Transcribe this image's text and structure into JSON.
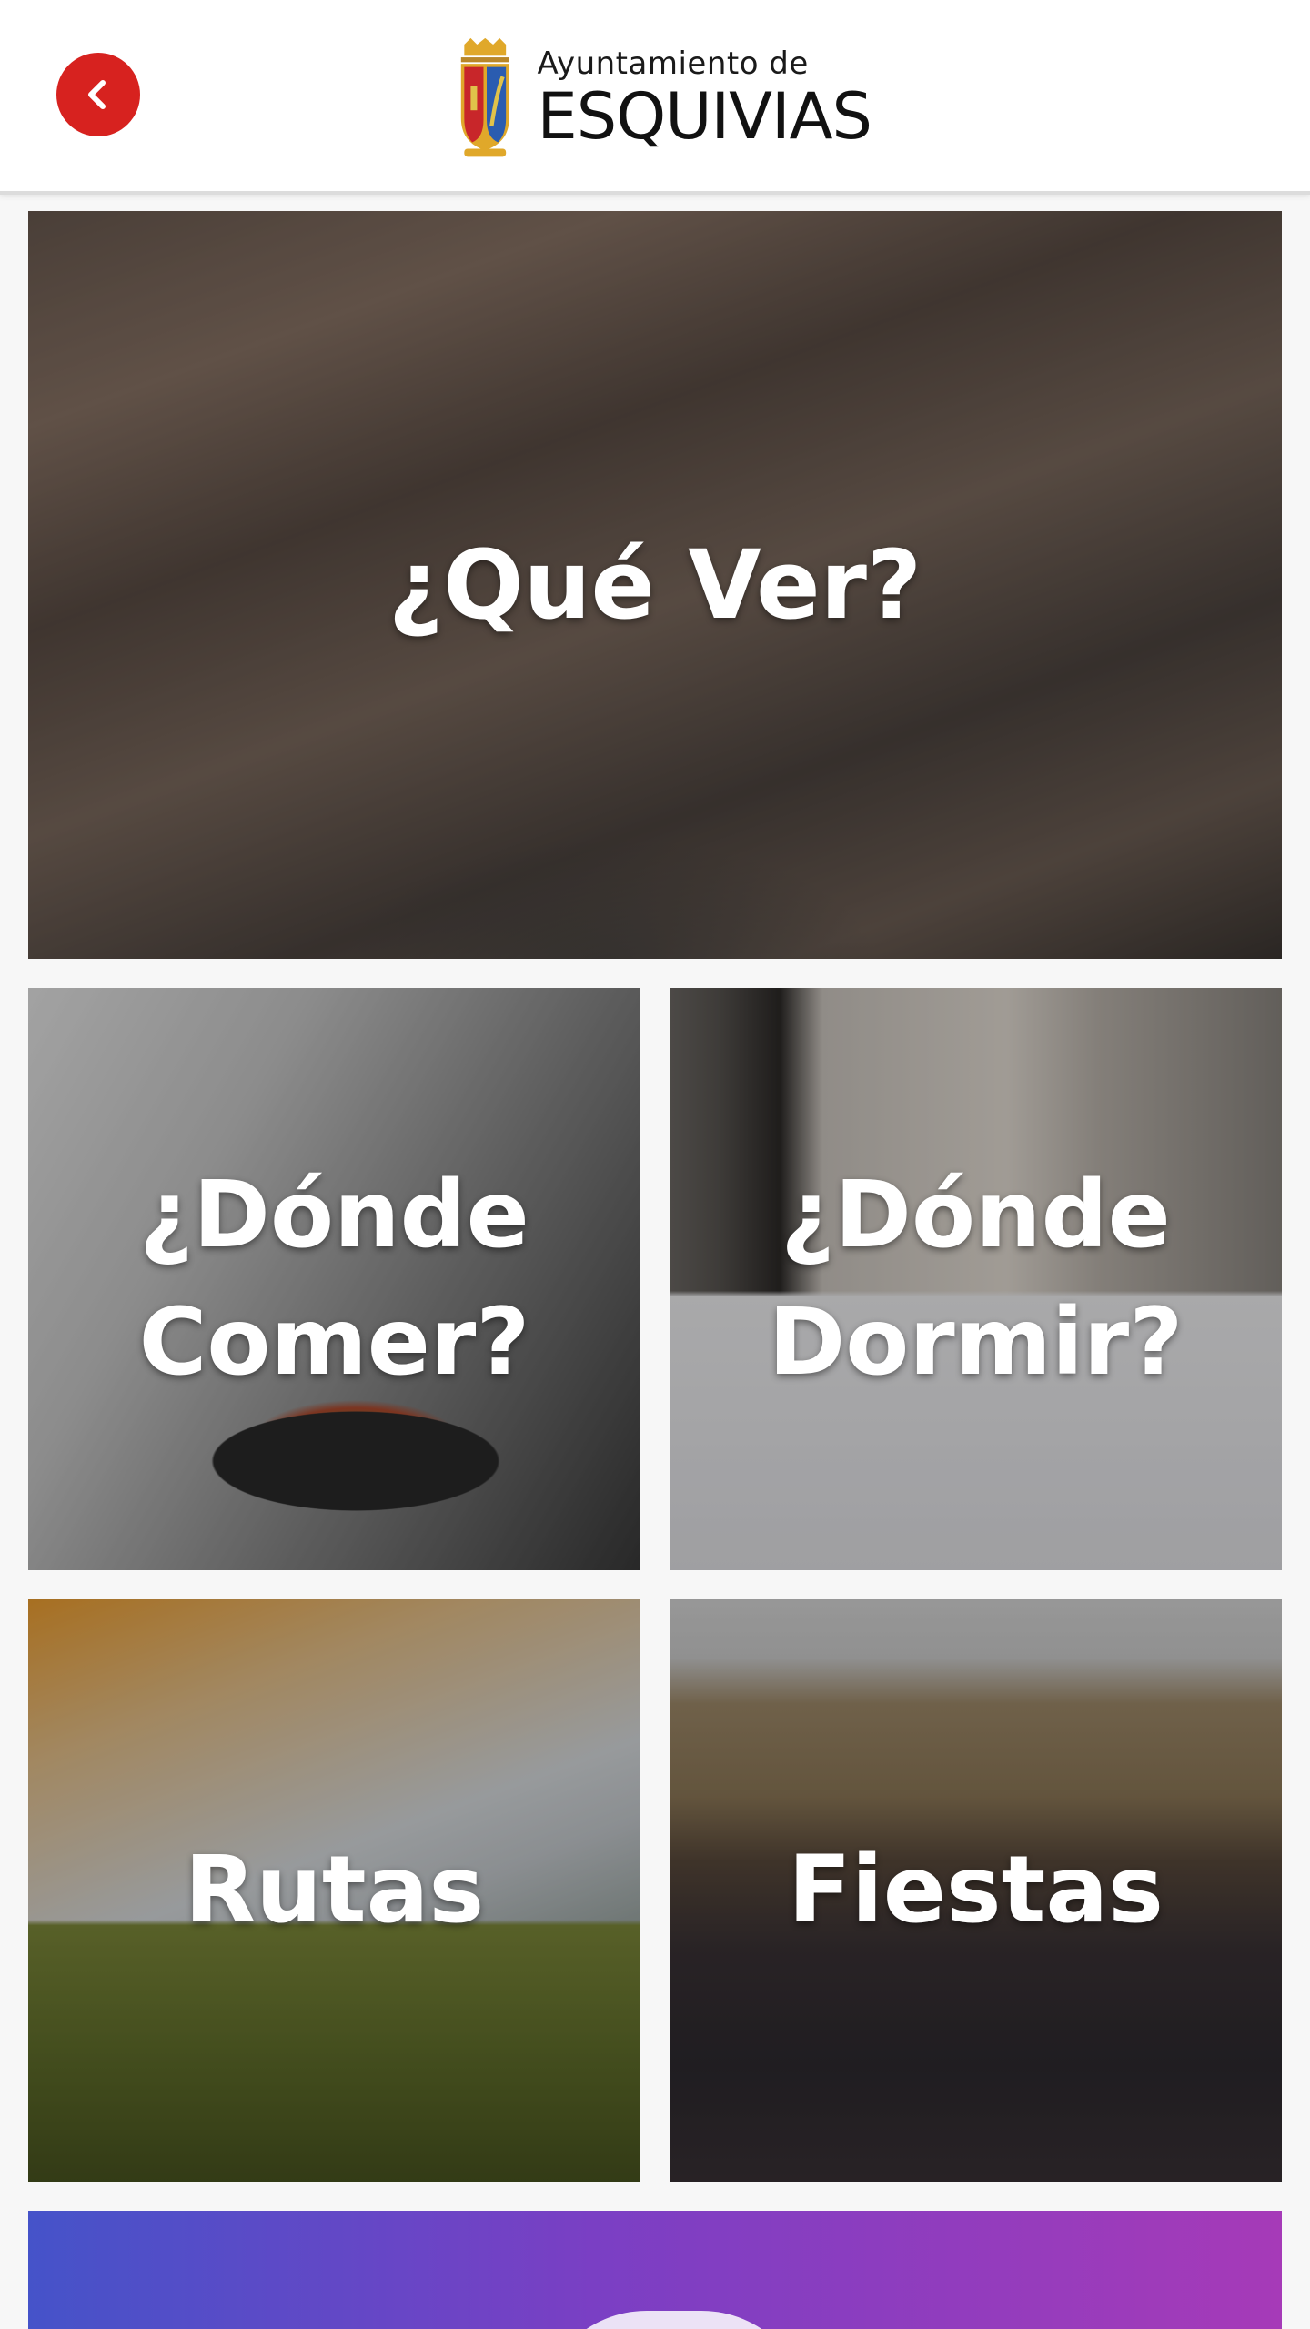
{
  "header": {
    "back_icon": "chevron-left-icon",
    "logo": {
      "line1": "Ayuntamiento de",
      "line2": "ESQUIVIAS"
    },
    "colors": {
      "back_button": "#d7221f",
      "background": "#ffffff"
    }
  },
  "tiles": [
    {
      "label": "¿Qué Ver?"
    },
    {
      "label": "¿Dónde\nComer?"
    },
    {
      "label": "¿Dónde\nDormir?"
    },
    {
      "label": "Rutas"
    },
    {
      "label": "Fiestas"
    }
  ],
  "promo": {
    "gradient": [
      "#4553c9",
      "#7a3fc4",
      "#a63ab8"
    ]
  }
}
